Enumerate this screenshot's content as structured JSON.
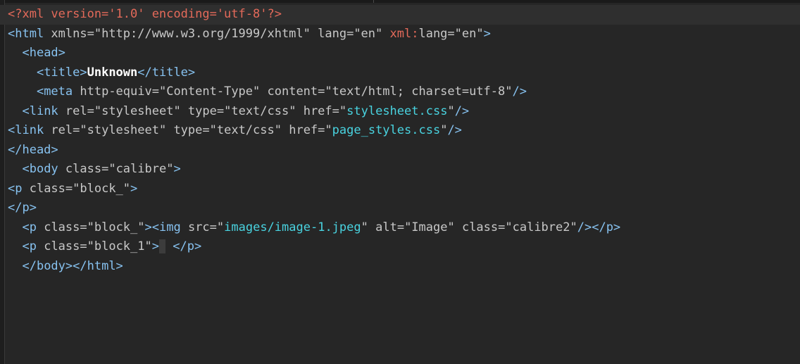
{
  "editor": {
    "lines": [
      [
        {
          "t": "<?xml version='1.0' encoding='utf-8'?>",
          "c": "pi"
        }
      ],
      [
        {
          "t": "<html",
          "c": "tag"
        },
        {
          "t": " xmlns=",
          "c": "attr"
        },
        {
          "t": "\"http://www.w3.org/1999/xhtml\"",
          "c": "val"
        },
        {
          "t": " lang=",
          "c": "attr"
        },
        {
          "t": "\"en\"",
          "c": "val"
        },
        {
          "t": " ",
          "c": "attr"
        },
        {
          "t": "xml:",
          "c": "ns"
        },
        {
          "t": "lang=",
          "c": "attr"
        },
        {
          "t": "\"en\"",
          "c": "val"
        },
        {
          "t": ">",
          "c": "tag"
        }
      ],
      [
        {
          "t": "  ",
          "c": "attr"
        },
        {
          "t": "<head>",
          "c": "tag"
        }
      ],
      [
        {
          "t": "    ",
          "c": "attr"
        },
        {
          "t": "<title>",
          "c": "tag"
        },
        {
          "t": "Unknown",
          "c": "text"
        },
        {
          "t": "</title>",
          "c": "tag"
        }
      ],
      [
        {
          "t": "    ",
          "c": "attr"
        },
        {
          "t": "<meta",
          "c": "tag"
        },
        {
          "t": " http-equiv=",
          "c": "attr"
        },
        {
          "t": "\"Content-Type\"",
          "c": "val"
        },
        {
          "t": " content=",
          "c": "attr"
        },
        {
          "t": "\"text/html; charset=utf-8\"",
          "c": "val"
        },
        {
          "t": "/>",
          "c": "tag"
        }
      ],
      [
        {
          "t": "  ",
          "c": "attr"
        },
        {
          "t": "<link",
          "c": "tag"
        },
        {
          "t": " rel=",
          "c": "attr"
        },
        {
          "t": "\"stylesheet\"",
          "c": "val"
        },
        {
          "t": " type=",
          "c": "attr"
        },
        {
          "t": "\"text/css\"",
          "c": "val"
        },
        {
          "t": " href=",
          "c": "attr"
        },
        {
          "t": "\"",
          "c": "val"
        },
        {
          "t": "stylesheet.css",
          "c": "url"
        },
        {
          "t": "\"",
          "c": "val"
        },
        {
          "t": "/>",
          "c": "tag"
        }
      ],
      [
        {
          "t": "<link",
          "c": "tag"
        },
        {
          "t": " rel=",
          "c": "attr"
        },
        {
          "t": "\"stylesheet\"",
          "c": "val"
        },
        {
          "t": " type=",
          "c": "attr"
        },
        {
          "t": "\"text/css\"",
          "c": "val"
        },
        {
          "t": " href=",
          "c": "attr"
        },
        {
          "t": "\"",
          "c": "val"
        },
        {
          "t": "page_styles.css",
          "c": "url"
        },
        {
          "t": "\"",
          "c": "val"
        },
        {
          "t": "/>",
          "c": "tag"
        }
      ],
      [
        {
          "t": "</head>",
          "c": "tag"
        }
      ],
      [
        {
          "t": "  ",
          "c": "attr"
        },
        {
          "t": "<body",
          "c": "tag"
        },
        {
          "t": " class=",
          "c": "attr"
        },
        {
          "t": "\"calibre\"",
          "c": "val"
        },
        {
          "t": ">",
          "c": "tag"
        }
      ],
      [
        {
          "t": "<p",
          "c": "tag"
        },
        {
          "t": " class=",
          "c": "attr"
        },
        {
          "t": "\"block_\"",
          "c": "val"
        },
        {
          "t": ">",
          "c": "tag"
        }
      ],
      [
        {
          "t": "</p>",
          "c": "tag"
        }
      ],
      [
        {
          "t": "  ",
          "c": "attr"
        },
        {
          "t": "<p",
          "c": "tag"
        },
        {
          "t": " class=",
          "c": "attr"
        },
        {
          "t": "\"block_\"",
          "c": "val"
        },
        {
          "t": ">",
          "c": "tag"
        },
        {
          "t": "<img",
          "c": "tag"
        },
        {
          "t": " src=",
          "c": "attr"
        },
        {
          "t": "\"",
          "c": "val"
        },
        {
          "t": "images/image-1.jpeg",
          "c": "url"
        },
        {
          "t": "\"",
          "c": "val"
        },
        {
          "t": " alt=",
          "c": "attr"
        },
        {
          "t": "\"Image\"",
          "c": "val"
        },
        {
          "t": " class=",
          "c": "attr"
        },
        {
          "t": "\"calibre2\"",
          "c": "val"
        },
        {
          "t": "/>",
          "c": "tag"
        },
        {
          "t": "</p>",
          "c": "tag"
        }
      ],
      [
        {
          "t": "  ",
          "c": "attr"
        },
        {
          "t": "<p",
          "c": "tag"
        },
        {
          "t": " class=",
          "c": "attr"
        },
        {
          "t": "\"block_1\"",
          "c": "val"
        },
        {
          "t": ">",
          "c": "tag"
        },
        {
          "t": " ",
          "c": "cursor"
        },
        {
          "t": " ",
          "c": "attr"
        },
        {
          "t": "</p>",
          "c": "tag"
        }
      ],
      [
        {
          "t": "  ",
          "c": "attr"
        },
        {
          "t": "</body>",
          "c": "tag"
        },
        {
          "t": "</html>",
          "c": "tag"
        }
      ]
    ]
  }
}
